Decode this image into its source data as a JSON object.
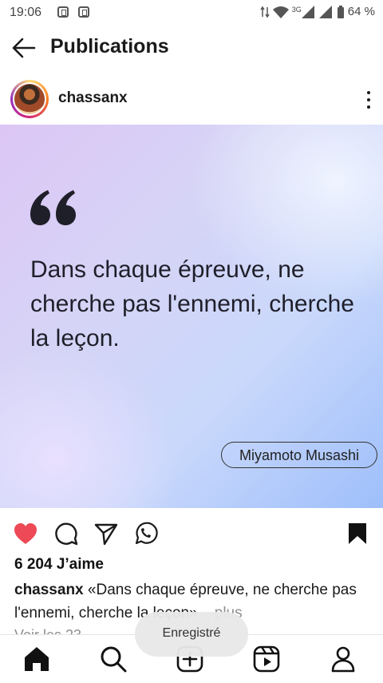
{
  "status": {
    "time": "19:06",
    "network": "3G",
    "battery": "64 %"
  },
  "header": {
    "title": "Publications"
  },
  "post": {
    "username": "chassanx",
    "quote": "Dans chaque épreuve, ne cherche pas l'ennemi, cherche la leçon.",
    "author": "Miyamoto Musashi",
    "likes": "6 204 J’aime",
    "caption_user": "chassanx",
    "caption_text": " «Dans chaque épreuve, ne cherche pas l'ennemi, cherche la leçon»",
    "caption_more": "... plus",
    "comments_partial": "Voir les 23 ..."
  },
  "toast": {
    "text": "Enregistré"
  },
  "colors": {
    "like": "#ed4956",
    "accent": "#111111"
  }
}
